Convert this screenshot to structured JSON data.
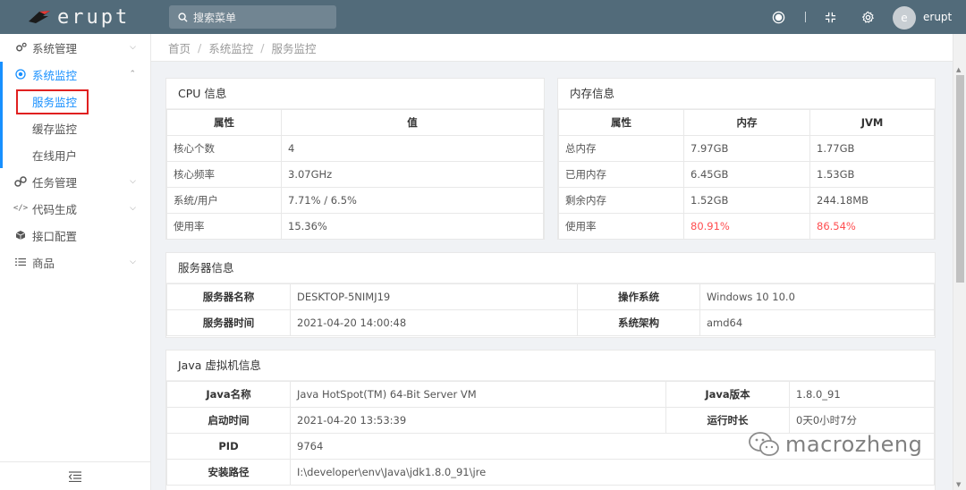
{
  "header": {
    "logo_text": "erupt",
    "search_placeholder": "搜索菜单",
    "user_initial": "e",
    "user_name": "erupt"
  },
  "sidebar": {
    "items": [
      {
        "label": "系统管理",
        "icon": "gears-icon"
      },
      {
        "label": "系统监控",
        "icon": "monitor-icon"
      },
      {
        "label": "任务管理",
        "icon": "cog-tasks-icon"
      },
      {
        "label": "代码生成",
        "icon": "code-icon"
      },
      {
        "label": "接口配置",
        "icon": "cube-icon"
      },
      {
        "label": "商品",
        "icon": "list-icon"
      }
    ],
    "sub_items": [
      {
        "label": "服务监控"
      },
      {
        "label": "缓存监控"
      },
      {
        "label": "在线用户"
      }
    ]
  },
  "breadcrumb": [
    "首页",
    "系统监控",
    "服务监控"
  ],
  "cpu": {
    "title": "CPU 信息",
    "headers": [
      "属性",
      "值"
    ],
    "rows": [
      [
        "核心个数",
        "4"
      ],
      [
        "核心频率",
        "3.07GHz"
      ],
      [
        "系统/用户",
        "7.71% / 6.5%"
      ],
      [
        "使用率",
        "15.36%"
      ]
    ]
  },
  "memory": {
    "title": "内存信息",
    "headers": [
      "属性",
      "内存",
      "JVM"
    ],
    "rows": [
      [
        "总内存",
        "7.97GB",
        "1.77GB"
      ],
      [
        "已用内存",
        "6.45GB",
        "1.53GB"
      ],
      [
        "剩余内存",
        "1.52GB",
        "244.18MB"
      ],
      [
        "使用率",
        "80.91%",
        "86.54%"
      ]
    ]
  },
  "server": {
    "title": "服务器信息",
    "rows": [
      [
        "服务器名称",
        "DESKTOP-5NIMJ19",
        "操作系统",
        "Windows 10 10.0"
      ],
      [
        "服务器时间",
        "2021-04-20 14:00:48",
        "系统架构",
        "amd64"
      ]
    ]
  },
  "jvm": {
    "title": "Java 虚拟机信息",
    "rows": [
      [
        "Java名称",
        "Java HotSpot(TM) 64-Bit Server VM",
        "Java版本",
        "1.8.0_91"
      ],
      [
        "启动时间",
        "2021-04-20 13:53:39",
        "运行时长",
        "0天0小时7分"
      ],
      [
        "PID",
        "9764"
      ],
      [
        "安装路径",
        "I:\\developer\\env\\Java\\jdk1.8.0_91\\jre"
      ]
    ]
  },
  "watermark": "macrozheng",
  "colors": {
    "header_bg": "#526b7a",
    "accent": "#1890ff",
    "warning": "#ff4d4f",
    "selection_box": "#e02020"
  }
}
